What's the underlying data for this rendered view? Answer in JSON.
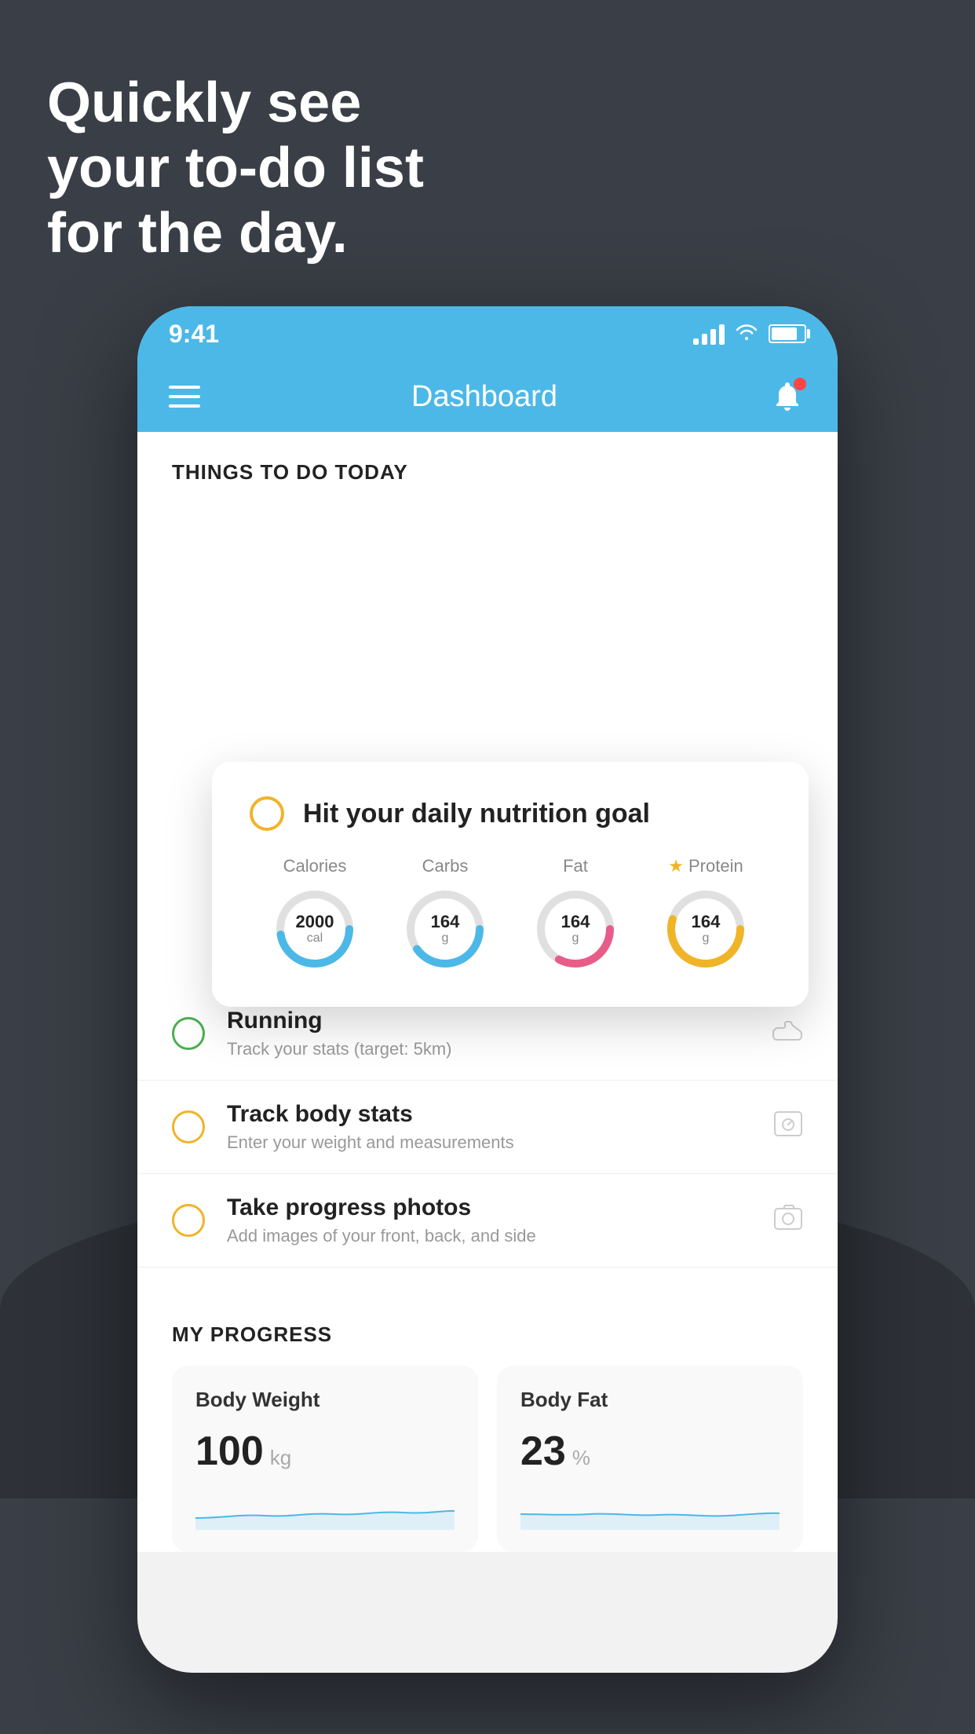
{
  "headline": {
    "line1": "Quickly see",
    "line2": "your to-do list",
    "line3": "for the day."
  },
  "phone": {
    "statusBar": {
      "time": "9:41"
    },
    "navBar": {
      "title": "Dashboard"
    },
    "thingsToDoSection": {
      "header": "THINGS TO DO TODAY"
    },
    "floatingCard": {
      "title": "Hit your daily nutrition goal",
      "nutrition": [
        {
          "label": "Calories",
          "value": "2000",
          "unit": "cal",
          "color": "#4cb8e8",
          "star": false
        },
        {
          "label": "Carbs",
          "value": "164",
          "unit": "g",
          "color": "#4cb8e8",
          "star": false
        },
        {
          "label": "Fat",
          "value": "164",
          "unit": "g",
          "color": "#e85c8a",
          "star": false
        },
        {
          "label": "Protein",
          "value": "164",
          "unit": "g",
          "color": "#f0b429",
          "star": true
        }
      ]
    },
    "todoItems": [
      {
        "title": "Running",
        "subtitle": "Track your stats (target: 5km)",
        "circleColor": "green",
        "icon": "shoe"
      },
      {
        "title": "Track body stats",
        "subtitle": "Enter your weight and measurements",
        "circleColor": "yellow",
        "icon": "scale"
      },
      {
        "title": "Take progress photos",
        "subtitle": "Add images of your front, back, and side",
        "circleColor": "yellow",
        "icon": "photo"
      }
    ],
    "progressSection": {
      "header": "MY PROGRESS",
      "cards": [
        {
          "title": "Body Weight",
          "value": "100",
          "unit": "kg"
        },
        {
          "title": "Body Fat",
          "value": "23",
          "unit": "%"
        }
      ]
    }
  }
}
